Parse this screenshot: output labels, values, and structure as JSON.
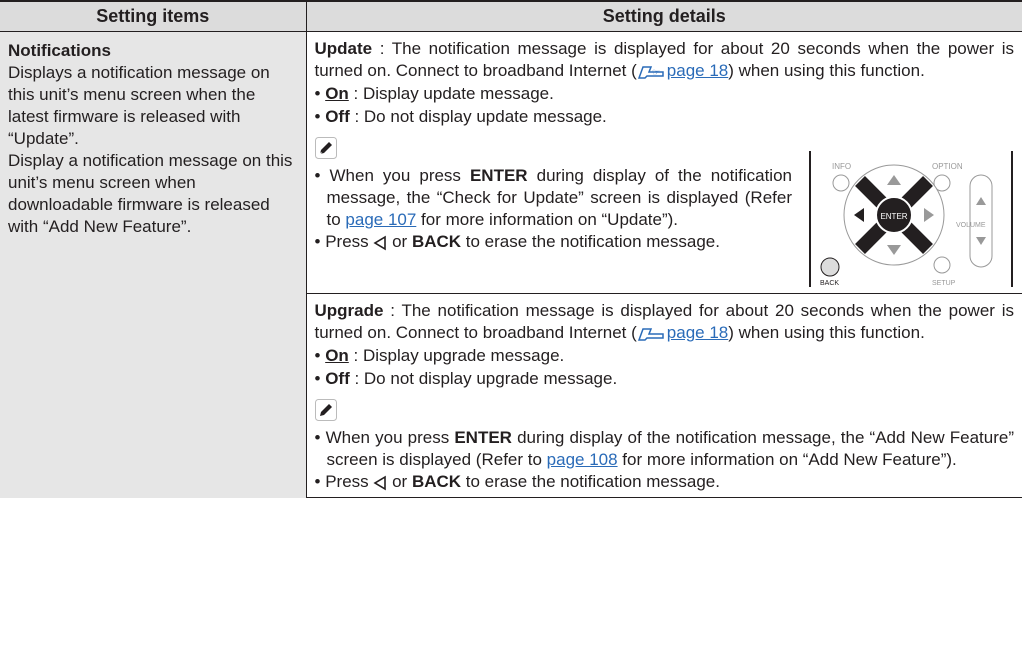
{
  "header": {
    "col1": "Setting items",
    "col2": "Setting details"
  },
  "left": {
    "title": "Notifications",
    "desc1": "Displays a notification message on this unit’s menu screen when the latest firmware is released with “Update”.",
    "desc2": "Display a notification message on this unit’s menu screen when downloadable firmware is released with “Add New Feature”."
  },
  "update": {
    "term": "Update",
    "text1": " : The notification message is displayed for about 20 seconds when the power is turned on. Connect to broadband Internet (",
    "link": "page 18",
    "text2": ") when using this function.",
    "on_label": "On",
    "on_text": " : Display update message.",
    "off_label": "Off",
    "off_text": " : Do not display update message.",
    "note1_a": "When you press ",
    "note1_enter": "ENTER",
    "note1_b": " during display of the notification message, the “Check for Update” screen is displayed (Refer to ",
    "note1_link": "page 107",
    "note1_c": " for more information on “Update”).",
    "note2_a": "Press ",
    "note2_or": " or ",
    "note2_back": "BACK",
    "note2_b": " to erase the notification message."
  },
  "remote": {
    "info": "INFO",
    "option": "OPTION",
    "enter": "ENTER",
    "volume": "VOLUME",
    "back": "BACK",
    "setup": "SETUP"
  },
  "upgrade": {
    "term": "Upgrade",
    "text1": " : The notification message is displayed for about 20 seconds when the power is turned on. Connect to broadband Internet (",
    "link": "page 18",
    "text2": ") when using this function.",
    "on_label": "On",
    "on_text": " : Display upgrade message.",
    "off_label": "Off",
    "off_text": " : Do not display upgrade message.",
    "note1_a": "When you press ",
    "note1_enter": "ENTER",
    "note1_b": " during display of the notification message, the “Add New Feature” screen is displayed (Refer to ",
    "note1_link": "page 108",
    "note1_c": " for more information on “Add New Feature”).",
    "note2_a": "Press ",
    "note2_or": " or ",
    "note2_back": "BACK",
    "note2_b": " to erase the notification message."
  },
  "icons": {
    "pencil": "pencil-note-icon",
    "pointer": "page-ref-icon",
    "back_triangle": "left-triangle-icon"
  }
}
